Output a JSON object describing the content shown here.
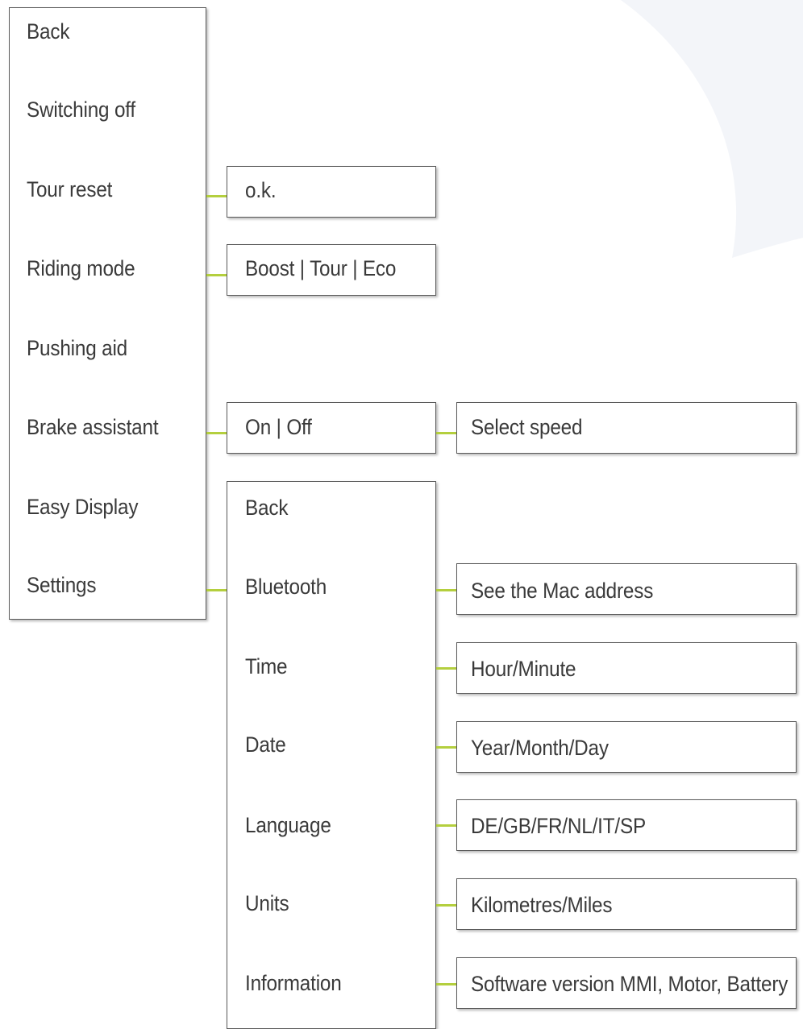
{
  "colors": {
    "connector": "#b4cf3e",
    "border": "#5a5a5a",
    "text": "#3a3a3a",
    "background_shape": "#f3f5f9"
  },
  "main_menu": [
    "Back",
    "Switching off",
    "Tour reset",
    "Riding mode",
    "Pushing aid",
    "Brake assistant",
    "Easy Display",
    "Settings"
  ],
  "tour_reset_option": "o.k.",
  "riding_mode_options": "Boost | Tour | Eco",
  "brake_assistant_options": "On | Off",
  "brake_assistant_sub": "Select speed",
  "settings_menu": [
    "Back",
    "Bluetooth",
    "Time",
    "Date",
    "Language",
    "Units",
    "Information"
  ],
  "settings_values": {
    "bluetooth": "See the Mac address",
    "time": "Hour/Minute",
    "date": "Year/Month/Day",
    "language": "DE/GB/FR/NL/IT/SP",
    "units": "Kilometres/Miles",
    "information": "Software version MMI, Motor, Battery"
  }
}
